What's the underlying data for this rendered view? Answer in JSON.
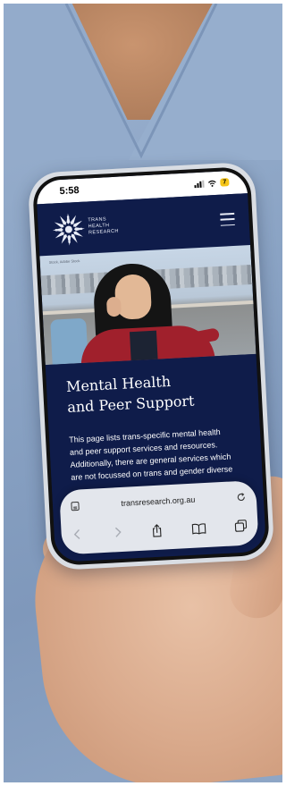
{
  "status_bar": {
    "time": "5:58",
    "battery": "7"
  },
  "site": {
    "logo": [
      "TRANS",
      "HEALTH",
      "RESEARCH"
    ],
    "hero_credit": "Stock, Adobe Stock"
  },
  "page": {
    "title": "Mental Health and Peer Support",
    "intro": "This page lists trans-specific mental health and peer support services and resources. Additionally, there are general services which are not focussed on trans and gender diverse"
  },
  "browser": {
    "url": "transresearch.org.au"
  },
  "icons": [
    "tabs-format-icon",
    "reload-icon",
    "back-icon",
    "forward-icon",
    "share-icon",
    "bookmarks-icon",
    "tabs-icon",
    "menu-icon",
    "wifi-icon"
  ],
  "colors": {
    "site_navy": "#0f1c4a",
    "scrubs_blue": "#8aa3c4",
    "battery_yellow": "#f5c518"
  }
}
